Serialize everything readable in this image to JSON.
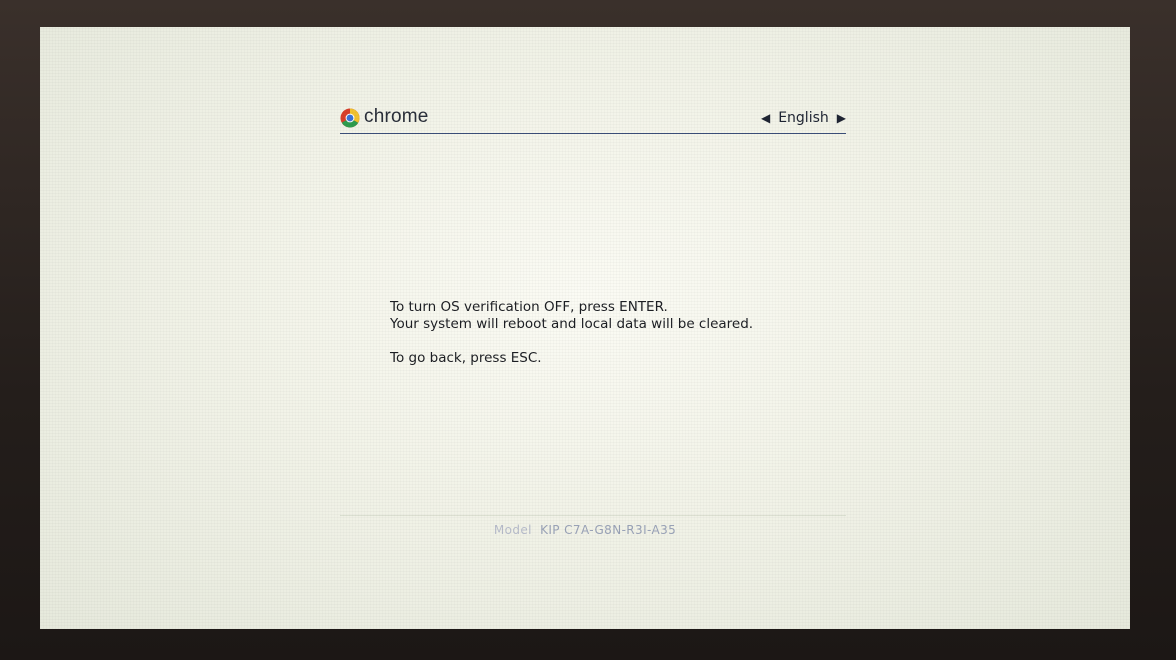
{
  "header": {
    "brand": "chrome",
    "language": "English",
    "prev_arrow": "◀",
    "next_arrow": "▶"
  },
  "message": {
    "line1": "To turn OS verification OFF, press ENTER.",
    "line2": "Your system will reboot and local data will be cleared.",
    "line3": "To go back, press ESC."
  },
  "footer": {
    "model_label": "Model",
    "model_value": "KIP C7A-G8N-R3I-A35"
  },
  "colors": {
    "header_rule": "#3b4f7a",
    "text": "#1d1f24",
    "model_text": "#9aa3b8"
  },
  "icons": {
    "logo": "chrome-logo-icon",
    "prev": "triangle-left-icon",
    "next": "triangle-right-icon"
  }
}
